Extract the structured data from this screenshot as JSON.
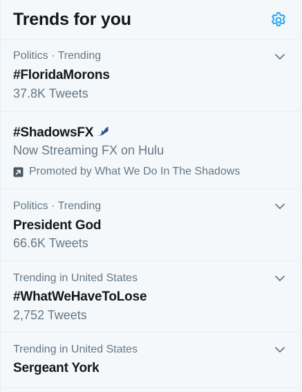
{
  "header": {
    "title": "Trends for you"
  },
  "trends": [
    {
      "context": "Politics · Trending",
      "name": "#FloridaMorons",
      "count": "37.8K Tweets"
    },
    {
      "name": "#ShadowsFX",
      "description": "Now Streaming FX on Hulu",
      "promoted": "Promoted by What We Do In The Shadows"
    },
    {
      "context": "Politics · Trending",
      "name": "President God",
      "count": "66.6K Tweets"
    },
    {
      "context": "Trending in United States",
      "name": "#WhatWeHaveToLose",
      "count": "2,752 Tweets"
    },
    {
      "context": "Trending in United States",
      "name": "Sergeant York"
    }
  ],
  "colors": {
    "accent": "#1da1f2",
    "text_primary": "#14171a",
    "text_secondary": "#657786",
    "background": "#f5f8fa",
    "divider": "#e6ecf0"
  },
  "icons": {
    "settings": "gear-icon",
    "more": "chevron-down-icon",
    "promoted": "promoted-arrow-icon",
    "hashflag": "bat-icon"
  }
}
